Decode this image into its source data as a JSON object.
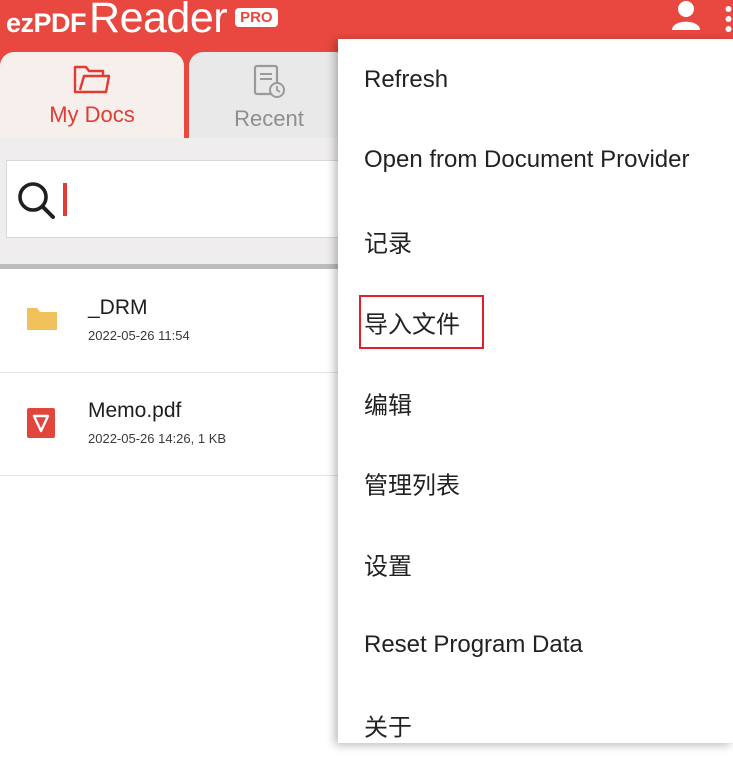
{
  "app": {
    "logo_brand": "ezPDF",
    "logo_name": "Reader",
    "logo_badge": "PRO"
  },
  "icons": {
    "user": "user-icon",
    "overflow": "overflow-menu-icon",
    "folder_open": "folder-open-icon",
    "recent_doc": "recent-document-icon",
    "search": "search-icon",
    "folder": "folder-icon",
    "pdf": "pdf-file-icon"
  },
  "colors": {
    "accent": "#e8483f",
    "tab_active_label": "#e23b31",
    "folder": "#f0c15a",
    "pdf": "#e2453c",
    "highlight": "#e0202a"
  },
  "tabs": [
    {
      "label": "My Docs",
      "active": true
    },
    {
      "label": "Recent",
      "active": false
    }
  ],
  "search": {
    "value": ""
  },
  "files": [
    {
      "name": "_DRM",
      "meta": "2022-05-26 11:54",
      "type": "folder"
    },
    {
      "name": "Memo.pdf",
      "meta": "2022-05-26 14:26, 1 KB",
      "type": "pdf"
    }
  ],
  "menu": {
    "items": [
      {
        "label": "Refresh"
      },
      {
        "label": "Open from Document Provider"
      },
      {
        "label": "记录"
      },
      {
        "label": "导入文件",
        "highlighted": true
      },
      {
        "label": "编辑"
      },
      {
        "label": "管理列表"
      },
      {
        "label": "设置"
      },
      {
        "label": "Reset Program Data"
      },
      {
        "label": "关于"
      }
    ]
  }
}
